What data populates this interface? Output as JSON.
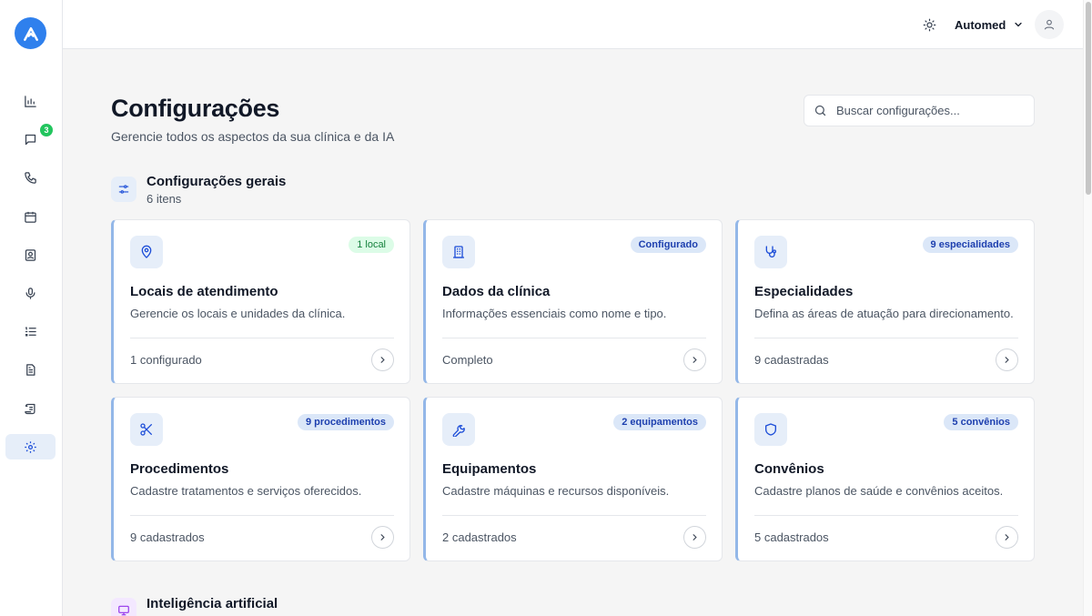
{
  "topbar": {
    "theme_icon": "sun-icon",
    "org_name": "Automed",
    "user_icon": "user-icon"
  },
  "sidebar": {
    "items": [
      {
        "icon": "bar-chart-icon",
        "label": ""
      },
      {
        "icon": "message-icon",
        "badge": "3"
      },
      {
        "icon": "phone-icon"
      },
      {
        "icon": "calendar-icon"
      },
      {
        "icon": "contact-icon"
      },
      {
        "icon": "microphone-icon"
      },
      {
        "icon": "list-ordered-icon"
      },
      {
        "icon": "file-text-icon"
      },
      {
        "icon": "scroll-icon"
      },
      {
        "icon": "gear-icon",
        "active": true
      }
    ]
  },
  "header": {
    "title": "Configurações",
    "subtitle": "Gerencie todos os aspectos da sua clínica e da IA"
  },
  "search": {
    "placeholder": "Buscar configurações..."
  },
  "sections": [
    {
      "title": "Configurações gerais",
      "count": "6 itens",
      "icon": "sliders-icon",
      "cards": [
        {
          "icon": "map-pin-icon",
          "badge": "1 local",
          "title": "Locais de atendimento",
          "description": "Gerencie os locais e unidades da clínica.",
          "status": "1 configurado"
        },
        {
          "icon": "building-icon",
          "badge": "Configurado",
          "title": "Dados da clínica",
          "description": "Informações essenciais como nome e tipo.",
          "status": "Completo"
        },
        {
          "icon": "stethoscope-icon",
          "badge": "9 especialidades",
          "title": "Especialidades",
          "description": "Defina as áreas de atuação para direcionamento.",
          "status": "9 cadastradas"
        },
        {
          "icon": "scissors-icon",
          "badge": "9 procedimentos",
          "title": "Procedimentos",
          "description": "Cadastre tratamentos e serviços oferecidos.",
          "status": "9 cadastrados"
        },
        {
          "icon": "wrench-icon",
          "badge": "2 equipamentos",
          "title": "Equipamentos",
          "description": "Cadastre máquinas e recursos disponíveis.",
          "status": "2 cadastrados"
        },
        {
          "icon": "shield-icon",
          "badge": "5 convênios",
          "title": "Convênios",
          "description": "Cadastre planos de saúde e convênios aceitos.",
          "status": "5 cadastrados"
        }
      ]
    },
    {
      "title": "Inteligência artificial",
      "icon": "monitor-icon"
    }
  ],
  "colors": {
    "accent": "#2f80ed",
    "card_accent_border": "#93b7e8",
    "badge_blue_bg": "#dbe7f8",
    "badge_green_bg": "#dcfce7",
    "notification_green": "#22c55e"
  }
}
